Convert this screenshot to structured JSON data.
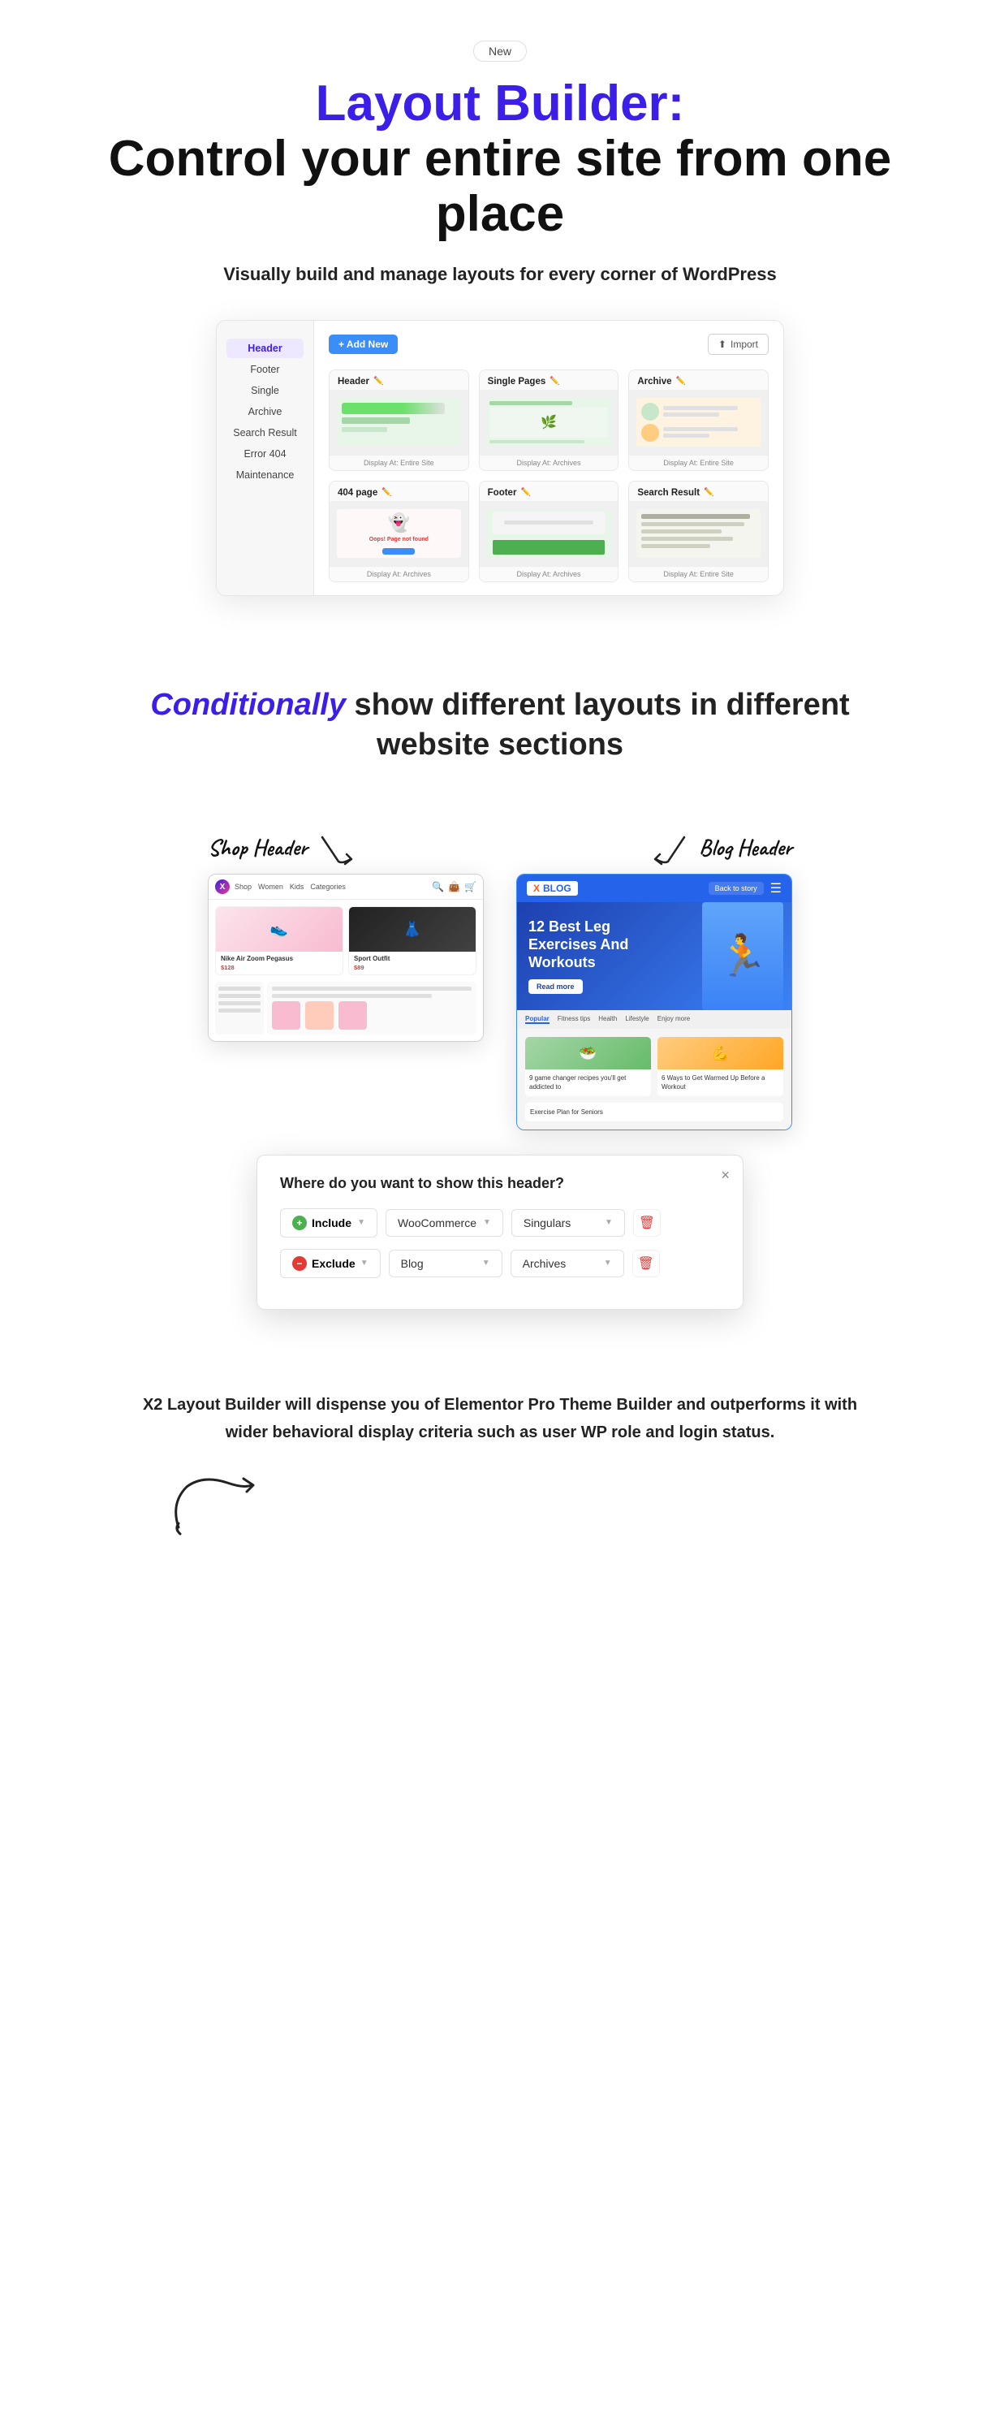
{
  "badge": {
    "label": "New"
  },
  "hero": {
    "title_colored": "Layout Builder:",
    "title_main": "Control your entire site from one place",
    "subtitle": "Visually build and manage layouts for every corner of WordPress"
  },
  "builder_mockup": {
    "toolbar": {
      "add_new": "+ Add New",
      "import": "Import"
    },
    "sidebar": {
      "items": [
        {
          "label": "Header",
          "active": false
        },
        {
          "label": "Footer",
          "active": false
        },
        {
          "label": "Single",
          "active": false
        },
        {
          "label": "Archive",
          "active": false
        },
        {
          "label": "Search Result",
          "active": false
        },
        {
          "label": "Error 404",
          "active": false
        },
        {
          "label": "Maintenance",
          "active": false
        }
      ]
    },
    "cards": [
      {
        "title": "Header",
        "footer": "Display At: Entire Site"
      },
      {
        "title": "Single Pages",
        "footer": "Display At: Archives"
      },
      {
        "title": "Archive",
        "footer": "Display At: Entire Site"
      },
      {
        "title": "404 page",
        "footer": "Display At: Archives"
      },
      {
        "title": "Footer",
        "footer": "Display At: Archives"
      },
      {
        "title": "Search Result",
        "footer": "Display At: Entire Site"
      }
    ]
  },
  "conditional_section": {
    "title_highlight": "Conditionally",
    "title_rest": " show different layouts in different website sections",
    "shop_header_label": "Shop Header",
    "blog_header_label": "Blog Header",
    "blog_hero_text": "12 Best Leg Exercises And Workouts",
    "blog_hero_btn": "Read more",
    "blog_back_btn": "Back to story",
    "blog_logo": "BLOG"
  },
  "dialog": {
    "title": "Where do you want to show this header?",
    "close": "×",
    "row1": {
      "include_label": "Include",
      "woocommerce_label": "WooCommerce",
      "singulars_label": "Singulars"
    },
    "row2": {
      "exclude_label": "Exclude",
      "blog_label": "Blog",
      "archives_label": "Archives"
    }
  },
  "description": {
    "text_bold": "X2 Layout Builder will dispense you of Elementor Pro Theme Builder and outperforms it with wider behavioral display criteria such as user WP role and login status."
  }
}
